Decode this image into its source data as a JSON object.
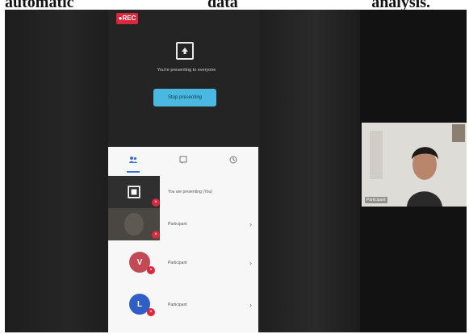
{
  "document": {
    "words": [
      "automatic",
      "data",
      "analysis."
    ]
  },
  "meeting": {
    "record_badge": "●REC",
    "presenting_message": "You're presenting to everyone",
    "stop_presenting_label": "Stop presenting"
  },
  "people_panel": {
    "tabs": [
      {
        "icon": "people-icon",
        "active": true
      },
      {
        "icon": "chat-icon",
        "active": false
      },
      {
        "icon": "activities-icon",
        "active": false
      }
    ],
    "participants": [
      {
        "label": "You are presenting (You)",
        "muted": true,
        "avatar": ""
      },
      {
        "label": "Participant",
        "muted": true,
        "avatar": ""
      },
      {
        "label": "Participant",
        "muted": true,
        "avatar": "V"
      },
      {
        "label": "Participant",
        "muted": true,
        "avatar": "L"
      }
    ]
  },
  "video_tile": {
    "name": "Participant"
  },
  "colors": {
    "record_red": "#d9283c",
    "stop_button_blue": "#4ab8e0",
    "tab_active_blue": "#3a6fd8"
  }
}
